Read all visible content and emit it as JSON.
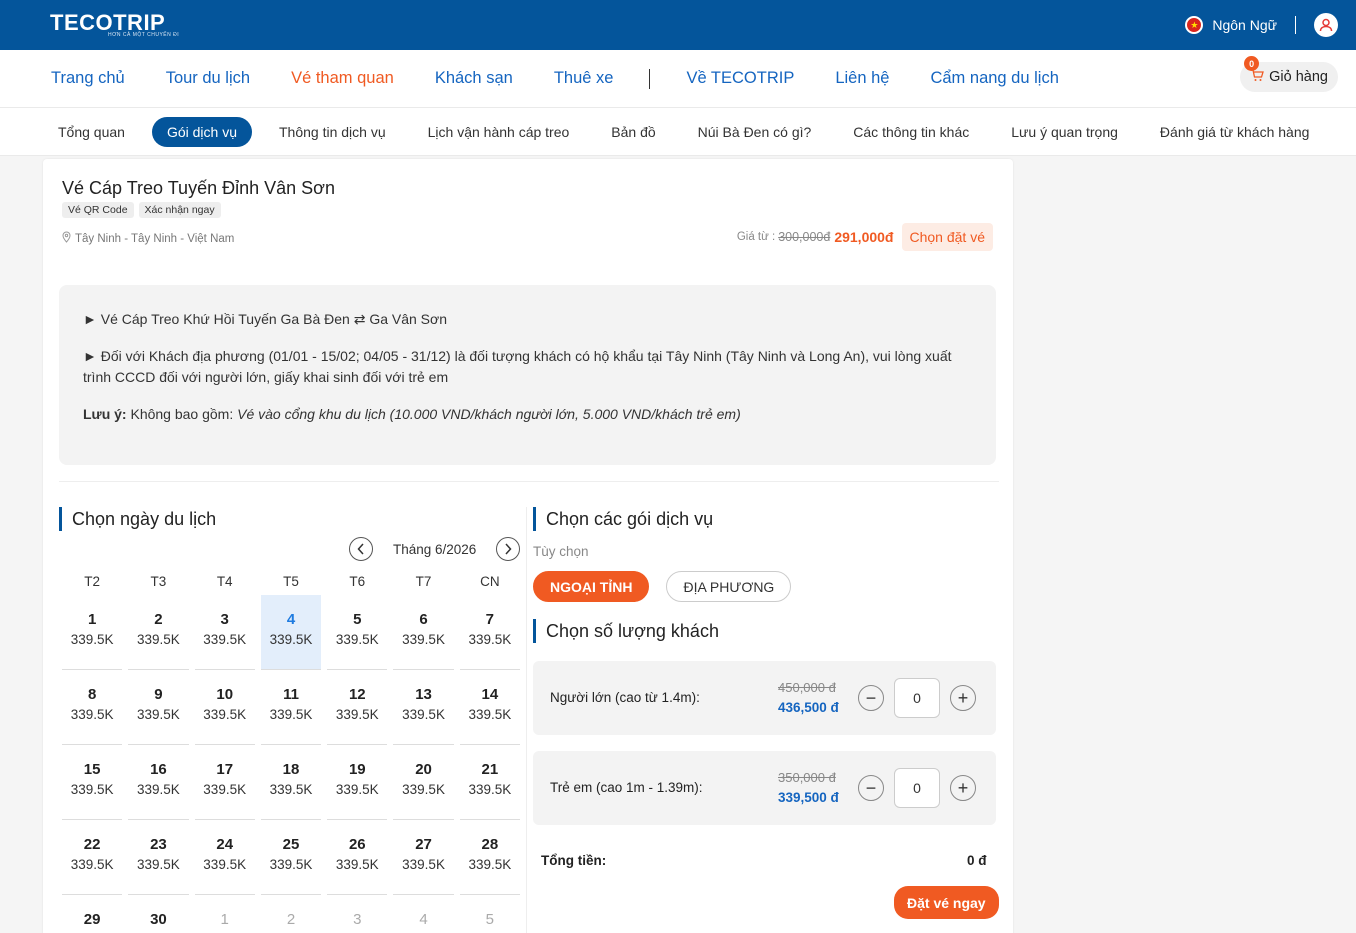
{
  "brand": {
    "logo": "TECOTRIP",
    "tagline": "HƠN CẢ MỘT CHUYẾN ĐI"
  },
  "topbar": {
    "language": "Ngôn Ngữ"
  },
  "mainnav": {
    "items": [
      "Trang chủ",
      "Tour du lịch",
      "Vé tham quan",
      "Khách sạn",
      "Thuê xe",
      "Về TECOTRIP",
      "Liên hệ",
      "Cẩm nang du lịch"
    ],
    "cart_label": "Giỏ hàng",
    "cart_count": "0"
  },
  "subnav": {
    "items": [
      "Tổng quan",
      "Gói dịch vụ",
      "Thông tin dịch vụ",
      "Lịch vận hành cáp treo",
      "Bản đồ",
      "Núi Bà Đen có gì?",
      "Các thông tin khác",
      "Lưu ý quan trọng",
      "Đánh giá từ khách hàng"
    ]
  },
  "product": {
    "title": "Vé Cáp Treo Tuyến Đỉnh Vân Sơn",
    "tags": [
      "Vé QR Code",
      "Xác nhận ngay"
    ],
    "location": "Tây Ninh - Tây Ninh - Việt Nam",
    "price_label": "Giá từ :",
    "price_old": "300,000đ",
    "price_new": "291,000đ",
    "choose_label": "Chọn đặt vé"
  },
  "description": {
    "line1": "► Vé Cáp Treo Khứ Hồi Tuyến Ga Bà Đen ⇄ Ga Vân Sơn",
    "line2": "► Đối với Khách địa phương (01/01 - 15/02; 04/05 - 31/12) là đối tượng khách có hộ khẩu tại Tây Ninh (Tây Ninh và Long An), vui lòng xuất trình CCCD đối với người lớn, giấy khai sinh đối với trẻ em",
    "note_label": "Lưu ý:",
    "note_prefix": " Không bao gồm: ",
    "note_italic": "Vé vào cổng khu du lịch (10.000 VND/khách người lớn, 5.000 VND/khách trẻ em)"
  },
  "calendar": {
    "title": "Chọn ngày du lịch",
    "month": "Tháng 6/2026",
    "weekdays": [
      "T2",
      "T3",
      "T4",
      "T5",
      "T6",
      "T7",
      "CN"
    ],
    "days": [
      {
        "n": "1",
        "p": "339.5K"
      },
      {
        "n": "2",
        "p": "339.5K"
      },
      {
        "n": "3",
        "p": "339.5K"
      },
      {
        "n": "4",
        "p": "339.5K",
        "selected": true
      },
      {
        "n": "5",
        "p": "339.5K"
      },
      {
        "n": "6",
        "p": "339.5K"
      },
      {
        "n": "7",
        "p": "339.5K"
      },
      {
        "n": "8",
        "p": "339.5K"
      },
      {
        "n": "9",
        "p": "339.5K"
      },
      {
        "n": "10",
        "p": "339.5K"
      },
      {
        "n": "11",
        "p": "339.5K"
      },
      {
        "n": "12",
        "p": "339.5K"
      },
      {
        "n": "13",
        "p": "339.5K"
      },
      {
        "n": "14",
        "p": "339.5K"
      },
      {
        "n": "15",
        "p": "339.5K"
      },
      {
        "n": "16",
        "p": "339.5K"
      },
      {
        "n": "17",
        "p": "339.5K"
      },
      {
        "n": "18",
        "p": "339.5K"
      },
      {
        "n": "19",
        "p": "339.5K"
      },
      {
        "n": "20",
        "p": "339.5K"
      },
      {
        "n": "21",
        "p": "339.5K"
      },
      {
        "n": "22",
        "p": "339.5K"
      },
      {
        "n": "23",
        "p": "339.5K"
      },
      {
        "n": "24",
        "p": "339.5K"
      },
      {
        "n": "25",
        "p": "339.5K"
      },
      {
        "n": "26",
        "p": "339.5K"
      },
      {
        "n": "27",
        "p": "339.5K"
      },
      {
        "n": "28",
        "p": "339.5K"
      },
      {
        "n": "29",
        "p": ""
      },
      {
        "n": "30",
        "p": ""
      },
      {
        "n": "1",
        "p": "",
        "muted": true
      },
      {
        "n": "2",
        "p": "",
        "muted": true
      },
      {
        "n": "3",
        "p": "",
        "muted": true
      },
      {
        "n": "4",
        "p": "",
        "muted": true
      },
      {
        "n": "5",
        "p": "",
        "muted": true
      }
    ]
  },
  "services": {
    "title": "Chọn các gói dịch vụ",
    "option_label": "Tùy chọn",
    "options": [
      "NGOẠI TỈNH",
      "ĐỊA PHƯƠNG"
    ]
  },
  "guests": {
    "title": "Chọn số lượng khách",
    "adult": {
      "label": "Người lớn (cao từ 1.4m):",
      "price_old": "450,000 đ",
      "price_new": "436,500 đ",
      "qty": "0"
    },
    "child": {
      "label": "Trẻ em (cao 1m - 1.39m):",
      "price_old": "350,000 đ",
      "price_new": "339,500 đ",
      "qty": "0"
    }
  },
  "total": {
    "label": "Tổng tiền:",
    "value": "0 đ"
  },
  "book_label": "Đặt vé ngay",
  "colors": {
    "primary": "#04559b",
    "accent": "#f05a22",
    "link": "#1565c0"
  }
}
